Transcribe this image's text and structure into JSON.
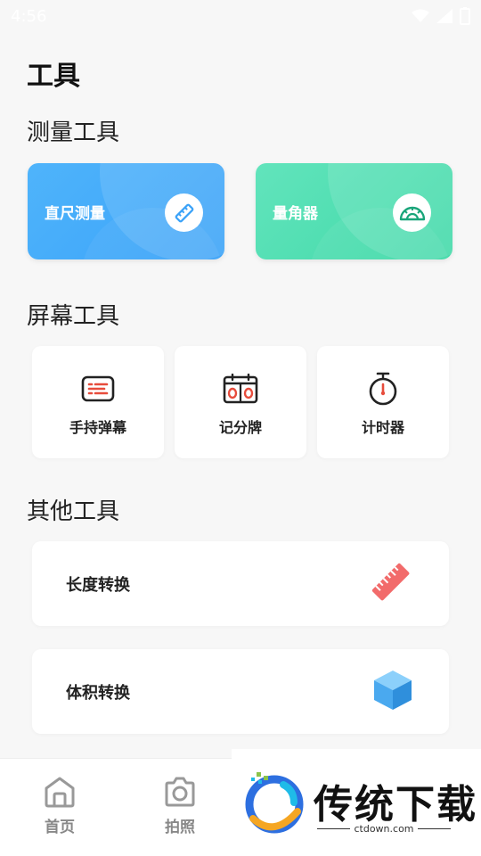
{
  "status_bar": {
    "time": "4:56"
  },
  "page_title": "工具",
  "sections": {
    "measure": "测量工具",
    "screen": "屏幕工具",
    "other": "其他工具"
  },
  "measure_cards": [
    {
      "label": "直尺测量",
      "icon": "ruler-icon"
    },
    {
      "label": "量角器",
      "icon": "protractor-icon"
    }
  ],
  "screen_tiles": [
    {
      "label": "手持弹幕",
      "icon": "barrage-icon"
    },
    {
      "label": "记分牌",
      "icon": "scoreboard-icon"
    },
    {
      "label": "计时器",
      "icon": "stopwatch-icon"
    }
  ],
  "other_rows": [
    {
      "label": "长度转换",
      "icon": "length-ruler-icon"
    },
    {
      "label": "体积转换",
      "icon": "cube-icon"
    }
  ],
  "bottom_nav": [
    {
      "label": "首页",
      "icon": "home-icon"
    },
    {
      "label": "拍照",
      "icon": "camera-icon"
    }
  ],
  "watermark": {
    "title": "传统下载",
    "url": "ctdown.com"
  },
  "colors": {
    "blue_card": "#3aa2f8",
    "green_card": "#40d9a8",
    "accent_red": "#e74c3c",
    "ruler_red": "#f26b6b",
    "cube_blue": "#4aa9ef"
  }
}
